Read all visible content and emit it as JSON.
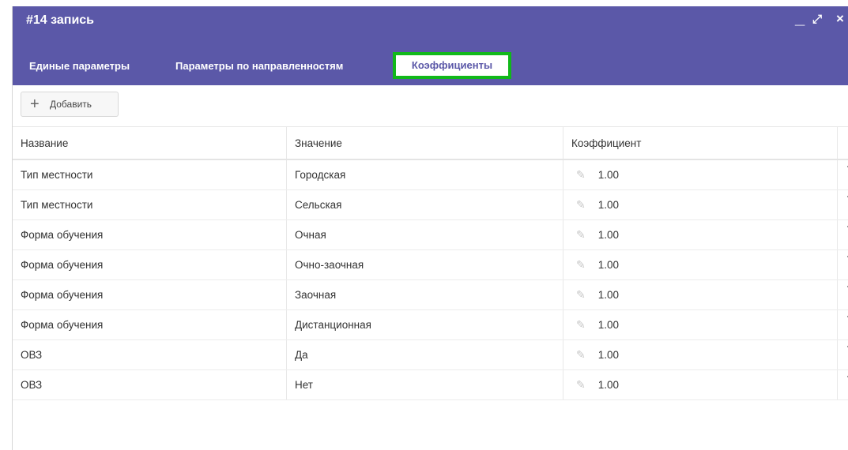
{
  "window": {
    "title": "#14 запись",
    "controls": {
      "minimize": "_",
      "maximize": "⤢",
      "close": "×"
    }
  },
  "tabs": [
    {
      "label": "Единые параметры",
      "active": false
    },
    {
      "label": "Параметры по направленностям",
      "active": false
    },
    {
      "label": "Коэффициенты",
      "active": true
    }
  ],
  "toolbar": {
    "add_label": "Добавить",
    "add_icon": "plus-icon"
  },
  "table": {
    "headers": [
      "Название",
      "Значение",
      "Коэффициент",
      ""
    ],
    "rows": [
      {
        "name": "Тип местности",
        "value": "Городская",
        "coef": "1.00"
      },
      {
        "name": "Тип местности",
        "value": "Сельская",
        "coef": "1.00"
      },
      {
        "name": "Форма обучения",
        "value": "Очная",
        "coef": "1.00"
      },
      {
        "name": "Форма обучения",
        "value": "Очно-заочная",
        "coef": "1.00"
      },
      {
        "name": "Форма обучения",
        "value": "Заочная",
        "coef": "1.00"
      },
      {
        "name": "Форма обучения",
        "value": "Дистанционная",
        "coef": "1.00"
      },
      {
        "name": "ОВЗ",
        "value": "Да",
        "coef": "1.00"
      },
      {
        "name": "ОВЗ",
        "value": "Нет",
        "coef": "1.00"
      }
    ]
  },
  "colors": {
    "header_bg": "#5b58a8",
    "active_tab_border": "#11b81a"
  }
}
